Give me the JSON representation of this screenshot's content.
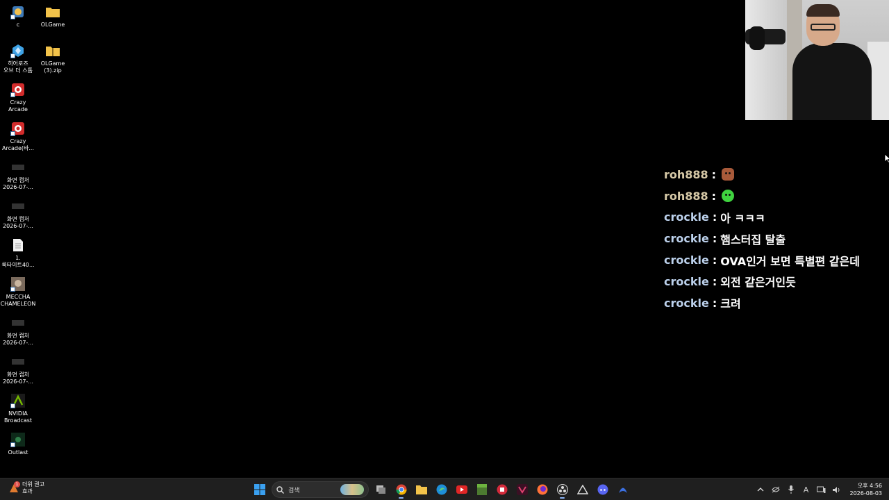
{
  "desktop_icons": [
    {
      "label": "c",
      "icon": "app-icon"
    },
    {
      "label": "OLGame",
      "icon": "folder-icon"
    },
    {
      "label": "히어로즈\n오브 더 스톰",
      "icon": "heroes-of-the-storm-icon"
    },
    {
      "label": "OLGame\n(3).zip",
      "icon": "zip-folder-icon"
    },
    {
      "label": "Crazy Arcade",
      "icon": "crazy-arcade-icon"
    },
    {
      "label": "Crazy\nArcade(바...",
      "icon": "crazy-arcade-icon"
    },
    {
      "label": "화면 캡처\n2026-07-...",
      "icon": "screenshot-icon"
    },
    {
      "label": "화면 캡처\n2026-07-...",
      "icon": "screenshot-icon"
    },
    {
      "label": "1.\n룩타이트40...",
      "icon": "document-icon"
    },
    {
      "label": "MECCHA\nCHAMELEON",
      "icon": "meccha-chameleon-icon"
    },
    {
      "label": "화면 캡처\n2026-07-...",
      "icon": "screenshot-icon"
    },
    {
      "label": "화면 캡처\n2026-07-...",
      "icon": "screenshot-icon"
    },
    {
      "label": "NVIDIA\nBroadcast",
      "icon": "nvidia-broadcast-icon"
    },
    {
      "label": "Outlast",
      "icon": "outlast-icon"
    }
  ],
  "chat": [
    {
      "user": "roh888",
      "message": "",
      "emote": "brown-emote",
      "color": "#d7c9a7"
    },
    {
      "user": "roh888",
      "message": "",
      "emote": "green-emote",
      "color": "#d7c9a7"
    },
    {
      "user": "crockle",
      "message": "아 ㅋㅋㅋ",
      "emote": "",
      "color": "#bcd1ec"
    },
    {
      "user": "crockle",
      "message": "햄스터집 탈출",
      "emote": "",
      "color": "#bcd1ec"
    },
    {
      "user": "crockle",
      "message": "OVA인거 보면 특별편 같은데",
      "emote": "",
      "color": "#bcd1ec"
    },
    {
      "user": "crockle",
      "message": "외전 같은거인듯",
      "emote": "",
      "color": "#bcd1ec"
    },
    {
      "user": "crockle",
      "message": "크려",
      "emote": "",
      "color": "#bcd1ec"
    }
  ],
  "chat_separator": ":",
  "taskbar": {
    "weather_line1": "더위 권고",
    "weather_line2": "효과",
    "weather_badge": "1",
    "search_placeholder": "검색",
    "apps": [
      "task-view-icon",
      "chrome-icon",
      "file-explorer-icon",
      "edge-icon",
      "youtube-icon",
      "minecraft-icon",
      "app-red-icon",
      "app-dark-icon",
      "firefox-icon",
      "obs-icon",
      "app-triangle-icon",
      "discord-icon",
      "app-blue-icon"
    ],
    "clock_time": "오후 4:56",
    "clock_date": "2026-08-03",
    "ime_label": "A"
  }
}
